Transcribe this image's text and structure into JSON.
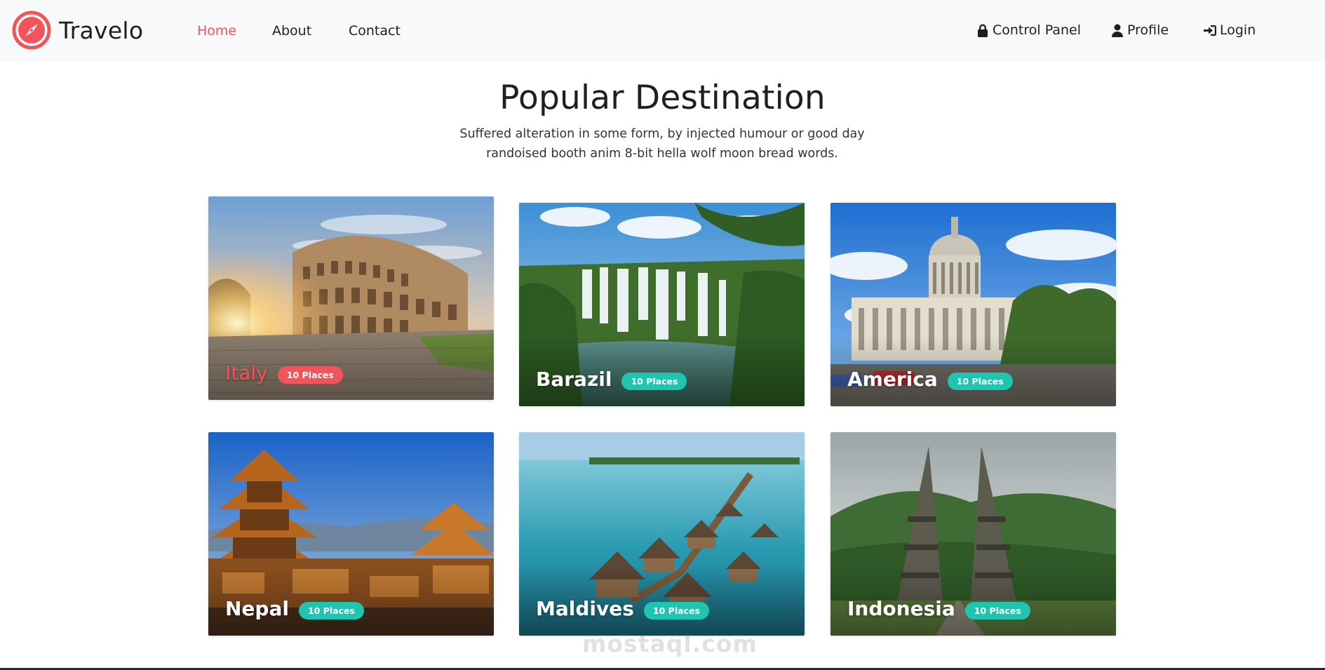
{
  "nav": {
    "brand": "Travelo",
    "links": [
      {
        "label": "Home",
        "active": true
      },
      {
        "label": "About",
        "active": false
      },
      {
        "label": "Contact",
        "active": false
      }
    ],
    "right": [
      {
        "label": "Control Panel",
        "icon": "lock-icon"
      },
      {
        "label": "Profile",
        "icon": "user-icon"
      },
      {
        "label": "Login",
        "icon": "login-icon"
      }
    ]
  },
  "header": {
    "title": "Popular Destination",
    "subtitle_line1": "Suffered alteration in some form, by injected humour or good day",
    "subtitle_line2": "randoised booth anim 8-bit hella wolf moon bread words."
  },
  "destinations": [
    {
      "name": "Italy",
      "badge": "10 Places",
      "highlighted": true
    },
    {
      "name": "Barazil",
      "badge": "10 Places",
      "highlighted": false
    },
    {
      "name": "America",
      "badge": "10 Places",
      "highlighted": false
    },
    {
      "name": "Nepal",
      "badge": "10 Places",
      "highlighted": false
    },
    {
      "name": "Maldives",
      "badge": "10 Places",
      "highlighted": false
    },
    {
      "name": "Indonesia",
      "badge": "10 Places",
      "highlighted": false
    }
  ],
  "watermark": "mostaql.com",
  "colors": {
    "accent": "#f2545b",
    "badge": "#1fc5b0",
    "navbar_bg": "#f8f9fa"
  }
}
